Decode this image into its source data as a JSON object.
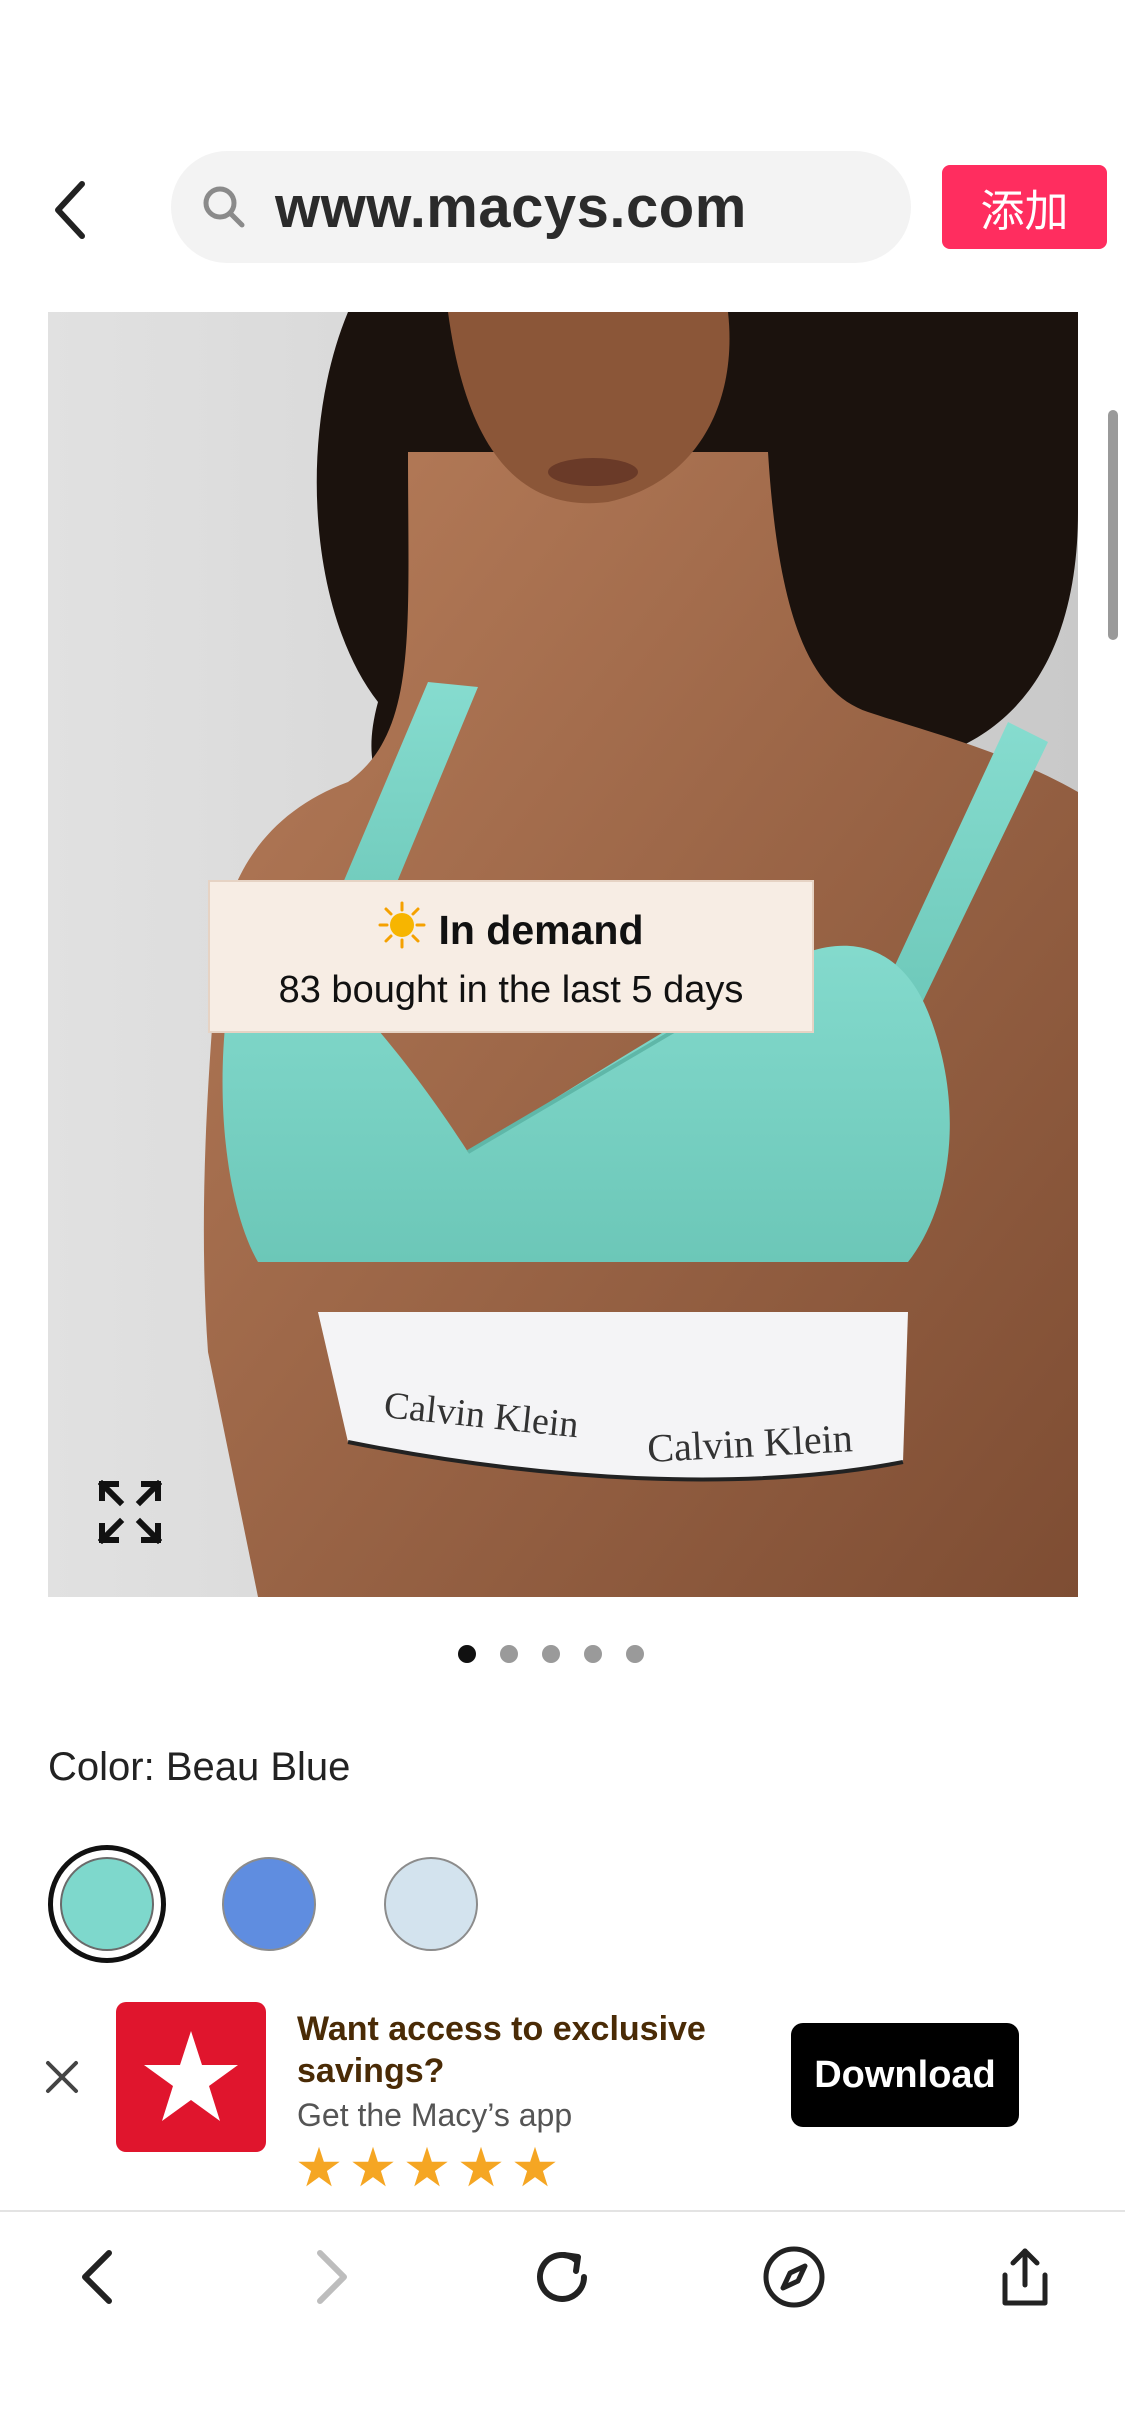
{
  "header": {
    "url": "www.macys.com",
    "add_label": "添加"
  },
  "product": {
    "badge_title": "In demand",
    "badge_sub": "83 bought in the last 5 days",
    "carousel_total": 5,
    "carousel_index": 1,
    "color_label": "Color: Beau Blue",
    "swatches": [
      {
        "name": "Beau Blue",
        "color": "#7ed8cc",
        "selected": true
      },
      {
        "name": "Blue",
        "color": "#5f8de0",
        "selected": false
      },
      {
        "name": "Light Blue",
        "color": "#d3e3ee",
        "selected": false
      }
    ]
  },
  "brand_marks": [
    "Calvin Klein",
    "Calvin Klein"
  ],
  "app_banner": {
    "title": "Want access to exclusive savings?",
    "subtitle": "Get the Macy’s app",
    "rating": 5,
    "download_label": "Download",
    "logo_color": "#e0152d"
  },
  "colors": {
    "accent": "#ff2d5f",
    "teal_fabric": "#79d3c5"
  },
  "bottom_bar": {
    "icons": [
      "back-icon",
      "forward-icon",
      "reload-icon",
      "compass-icon",
      "share-icon"
    ]
  }
}
